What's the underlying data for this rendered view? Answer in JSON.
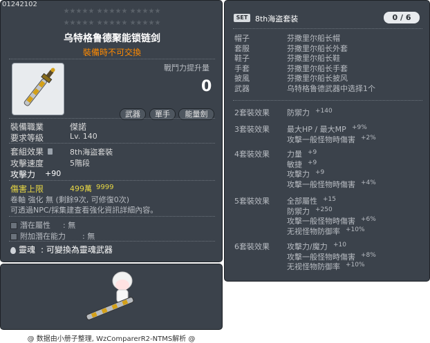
{
  "item_id": "01242102",
  "stars": [
    "★★★★★ ★★★★★ ★★★★★",
    "★★★★★ ★★★★★ ★★★★★"
  ],
  "item": {
    "name": "乌特格鲁德聚能锁链剑",
    "trade_note": "裝備時不可交換",
    "power_label": "戰鬥力提升量",
    "power_value": "0",
    "tags": [
      "武器",
      "單手",
      "能量劍"
    ]
  },
  "requirements": {
    "job_label": "裝備職業",
    "job_value": "傑諾",
    "level_label": "要求等級",
    "level_value": "Lv. 140"
  },
  "stats": {
    "set_label": "套組效果",
    "set_value": "8th海盜套裝",
    "speed_label": "攻擊速度",
    "speed_value": "5階段",
    "attack_label": "攻擊力",
    "attack_value": "+90"
  },
  "damage_cap": {
    "label": "傷害上限",
    "value1": "499萬",
    "value2": "9999"
  },
  "upgrade_text": "卷軸 強化 無 (剩餘9次, 可修復0次)",
  "npc_text": "可透過NPC/採集建查看強化資訊詳細內容。",
  "potential": {
    "hidden_label": "潛在屬性",
    "hidden_value": ": 無",
    "additional_label": "附加潛在能力",
    "additional_value": ": 無"
  },
  "soul": {
    "label": "靈魂",
    "text": ": 可變換為靈魂武器"
  },
  "footer": "@ 数据由小册子整理, WzComparerR2-NTMS解析 @",
  "set_panel": {
    "badge": "SET",
    "title": "8th海盗套装",
    "count": "0 / 6",
    "pieces": [
      {
        "slot": "帽子",
        "name": "芬撒里尔船长帽"
      },
      {
        "slot": "套服",
        "name": "芬撒里尔船长外套"
      },
      {
        "slot": "鞋子",
        "name": "芬撒里尔船长鞋"
      },
      {
        "slot": "手套",
        "name": "芬撒里尔船长手套"
      },
      {
        "slot": "披風",
        "name": "芬撒里尔船长披风"
      },
      {
        "slot": "武器",
        "name": "乌特格鲁德武器中选择1个"
      }
    ],
    "effects": [
      {
        "title": "2套裝效果",
        "lines": [
          {
            "k": "防禦力",
            "v": "+140"
          }
        ]
      },
      {
        "title": "3套裝效果",
        "lines": [
          {
            "k": "最大HP / 最大MP",
            "v": "+9%"
          },
          {
            "k": "攻擊一般怪物時傷害",
            "v": "+2%"
          }
        ]
      },
      {
        "title": "4套裝效果",
        "lines": [
          {
            "k": "力量",
            "v": "+9"
          },
          {
            "k": "敏捷",
            "v": "+9"
          },
          {
            "k": "攻擊力",
            "v": "+9"
          },
          {
            "k": "攻擊一般怪物時傷害",
            "v": "+4%"
          }
        ]
      },
      {
        "title": "5套裝效果",
        "lines": [
          {
            "k": "全部屬性",
            "v": "+15"
          },
          {
            "k": "防禦力",
            "v": "+250"
          },
          {
            "k": "攻擊一般怪物時傷害",
            "v": "+6%"
          },
          {
            "k": "无视怪物防御率",
            "v": "+10%"
          }
        ]
      },
      {
        "title": "6套裝效果",
        "lines": [
          {
            "k": "攻擊力/魔力",
            "v": "+10"
          },
          {
            "k": "攻擊一般怪物時傷害",
            "v": "+8%"
          },
          {
            "k": "无视怪物防御率",
            "v": "+10%"
          }
        ]
      }
    ]
  },
  "colors": {
    "panel": "#3b424b",
    "orange": "#ff8a00",
    "yellow": "#e8d844"
  }
}
